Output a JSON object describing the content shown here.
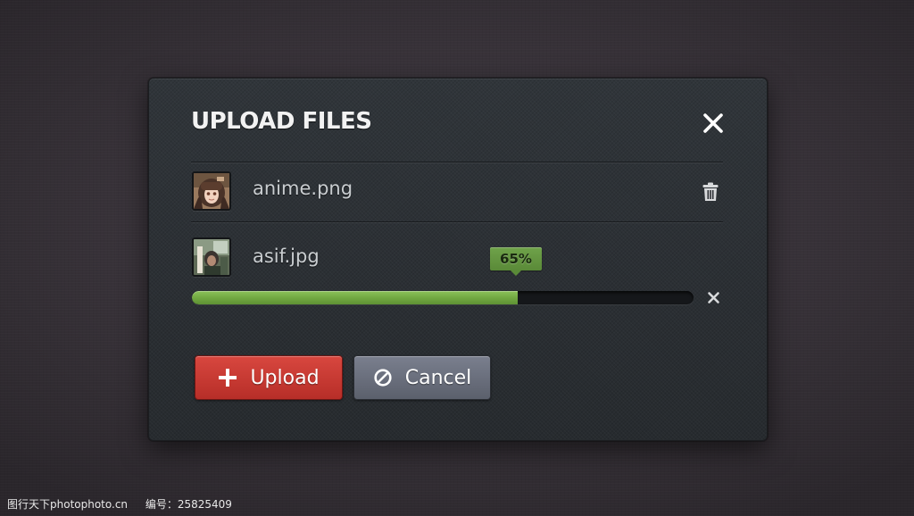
{
  "dialog": {
    "title": "UPLOAD FILES",
    "close_icon": "close-icon"
  },
  "files": [
    {
      "name": "anime.png",
      "thumbnail": "anime-thumbnail",
      "action_icon": "trash-icon"
    },
    {
      "name": "asif.jpg",
      "thumbnail": "photo-thumbnail",
      "progress": 0.65,
      "progress_label": "65%",
      "action_icon": "close-icon"
    }
  ],
  "buttons": {
    "upload_label": "Upload",
    "upload_icon": "plus-icon",
    "cancel_label": "Cancel",
    "cancel_icon": "cancel-icon"
  },
  "colors": {
    "upload_button": "#c8352f",
    "cancel_button": "#6a6f7c",
    "progress_fill": "#72a942",
    "badge": "#64963f"
  },
  "watermark": {
    "site": "图行天下photophoto.cn",
    "id_text": "编号：25825409"
  }
}
